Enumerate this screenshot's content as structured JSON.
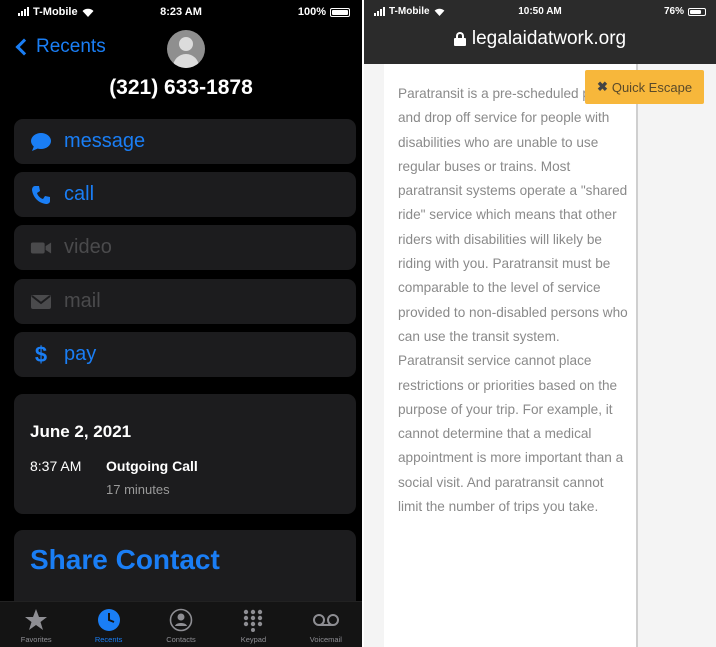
{
  "left_phone": {
    "status": {
      "carrier": "T-Mobile",
      "time": "8:23 AM",
      "battery": "100%"
    },
    "nav": {
      "back_label": "Recents"
    },
    "contact": {
      "phone_number": "(321) 633-1878"
    },
    "actions": [
      {
        "label": "message",
        "icon": "message-bubble-icon",
        "enabled": true
      },
      {
        "label": "call",
        "icon": "phone-icon",
        "enabled": true
      },
      {
        "label": "video",
        "icon": "video-camera-icon",
        "enabled": false
      },
      {
        "label": "mail",
        "icon": "envelope-icon",
        "enabled": false
      },
      {
        "label": "pay",
        "icon": "dollar-icon",
        "enabled": true
      }
    ],
    "call_history": {
      "date": "June 2, 2021",
      "time": "8:37 AM",
      "type": "Outgoing Call",
      "duration": "17 minutes"
    },
    "share_contact_label": "Share Contact",
    "tabbar": {
      "favorites": "Favorites",
      "recents": "Recents",
      "contacts": "Contacts",
      "keypad": "Keypad",
      "voicemail": "Voicemail",
      "selected": "recents"
    },
    "accent_color": "#1a7ef5"
  },
  "right_phone": {
    "status": {
      "carrier": "T-Mobile",
      "time": "10:50 AM",
      "battery": "76%"
    },
    "url": "legalaidatwork.org",
    "quick_escape_label": "Quick Escape",
    "article_text": "Paratransit is a pre-scheduled pick up and drop off service for people with disabilities who are unable to use regular buses or trains. Most paratransit systems operate a \"shared ride\" service which means that other riders with disabilities will likely be riding with you. Paratransit must be comparable to the level of service provided to non-disabled persons who can use the transit system. Paratransit service cannot place restrictions or priorities based on the purpose of your trip. For example, it cannot determine that a medical appointment is more important than a social visit. And paratransit cannot limit the number of trips you take.",
    "escape_color": "#f7b73b"
  }
}
